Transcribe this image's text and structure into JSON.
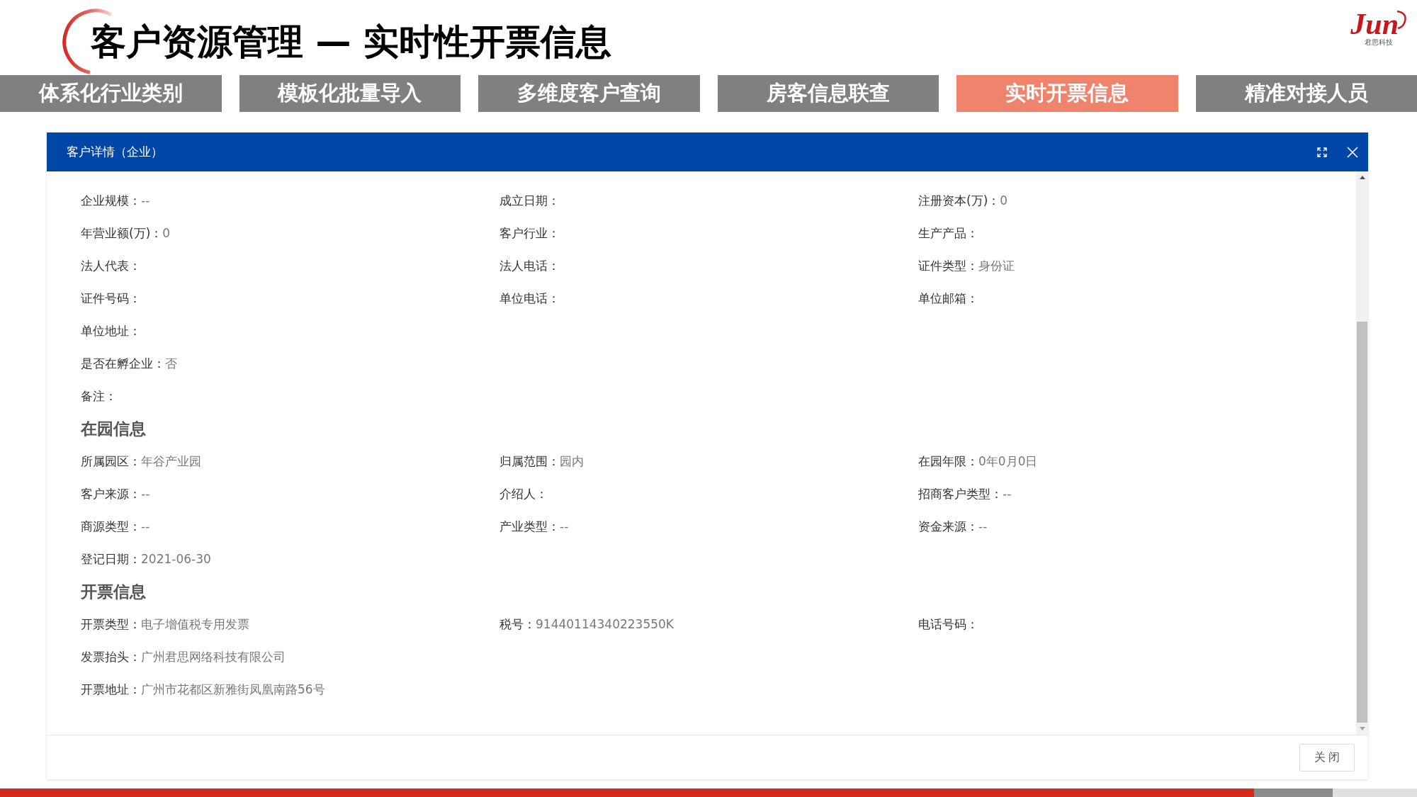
{
  "title": "客户资源管理 — 实时性开票信息",
  "logo": {
    "mark": "Jun",
    "caption": "君思科技"
  },
  "tabs": [
    {
      "label": "体系化行业类别",
      "selected": false
    },
    {
      "label": "模板化批量导入",
      "selected": false
    },
    {
      "label": "多维度客户查询",
      "selected": false
    },
    {
      "label": "房客信息联查",
      "selected": false
    },
    {
      "label": "实时开票信息",
      "selected": true
    },
    {
      "label": "精准对接人员",
      "selected": false
    }
  ],
  "dialog": {
    "title": "客户详情（企业）",
    "sections": [
      {
        "rows": [
          [
            {
              "label": "企业规模：",
              "value": "--"
            },
            {
              "label": "成立日期："
            },
            {
              "label": "注册资本(万)：",
              "value": "0"
            }
          ],
          [
            {
              "label": "年营业额(万)：",
              "value": "0"
            },
            {
              "label": "客户行业："
            },
            {
              "label": "生产产品："
            }
          ],
          [
            {
              "label": "法人代表："
            },
            {
              "label": "法人电话："
            },
            {
              "label": "证件类型：",
              "value": "身份证"
            }
          ],
          [
            {
              "label": "证件号码："
            },
            {
              "label": "单位电话："
            },
            {
              "label": "单位邮箱："
            }
          ],
          [
            {
              "label": "单位地址："
            }
          ],
          [
            {
              "label": "是否在孵企业：",
              "value": "否"
            }
          ],
          [
            {
              "label": "备注："
            }
          ]
        ]
      },
      {
        "heading": "在园信息",
        "rows": [
          [
            {
              "label": "所属园区：",
              "value": "年谷产业园"
            },
            {
              "label": "归属范围：",
              "value": "园内"
            },
            {
              "label": "在园年限：",
              "value": "0年0月0日"
            }
          ],
          [
            {
              "label": "客户来源：",
              "value": "--"
            },
            {
              "label": "介绍人："
            },
            {
              "label": "招商客户类型：",
              "value": "--"
            }
          ],
          [
            {
              "label": "商源类型：",
              "value": "--"
            },
            {
              "label": "产业类型：",
              "value": "--"
            },
            {
              "label": "资金来源：",
              "value": "--"
            }
          ],
          [
            {
              "label": "登记日期：",
              "value": "2021-06-30"
            }
          ]
        ]
      },
      {
        "heading": "开票信息",
        "rows": [
          [
            {
              "label": "开票类型：",
              "value": "电子增值税专用发票"
            },
            {
              "label": "税号：",
              "value": "91440114340223550K"
            },
            {
              "label": "电话号码："
            }
          ],
          [
            {
              "label": "发票抬头：",
              "value": "广州君思网络科技有限公司"
            }
          ],
          [
            {
              "label": "开票地址：",
              "value": "广州市花都区新雅街凤凰南路56号"
            }
          ]
        ]
      }
    ],
    "close_button": "关闭"
  }
}
